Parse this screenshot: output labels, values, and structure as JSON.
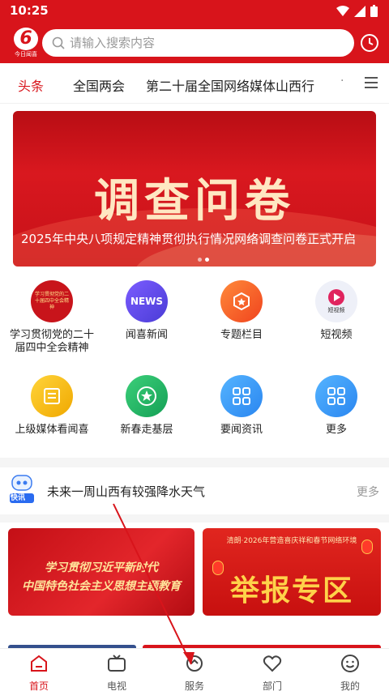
{
  "status_bar": {
    "time": "10:25"
  },
  "header": {
    "logo_text": "今日闻喜",
    "search_placeholder": "请输入搜索内容"
  },
  "tabs": [
    {
      "label": "头条",
      "active": true
    },
    {
      "label": "全国两会",
      "active": false
    },
    {
      "label": "第二十届全国网络媒体山西行",
      "active": false
    }
  ],
  "tabs_more": "·",
  "banner": {
    "headline": "调查问卷",
    "caption": "2025年中央八项规定精神贯彻执行情况网络调查问卷正式开启",
    "slides": 2,
    "active_slide": 2
  },
  "grid": [
    {
      "label": "学习贯彻党的二十届四中全会精神",
      "icon": "party-badge-icon",
      "icon_text": "学习贯彻党的二十届四中全会精神"
    },
    {
      "label": "闻喜新闻",
      "icon": "news-icon",
      "icon_text": "NEWS"
    },
    {
      "label": "专题栏目",
      "icon": "topic-star-icon",
      "icon_text": ""
    },
    {
      "label": "短视频",
      "icon": "short-video-icon",
      "icon_text": "短视频"
    },
    {
      "label": "上级媒体看闻喜",
      "icon": "media-icon",
      "icon_text": ""
    },
    {
      "label": "新春走基层",
      "icon": "spring-star-icon",
      "icon_text": ""
    },
    {
      "label": "要闻资讯",
      "icon": "apps-icon",
      "icon_text": ""
    },
    {
      "label": "更多",
      "icon": "more-apps-icon",
      "icon_text": ""
    }
  ],
  "flash": {
    "badge": "快讯",
    "title": "未来一周山西有较强降水天气",
    "more": "更多"
  },
  "promos": [
    {
      "line1": "学习贯彻习近平新时代",
      "line2": "中国特色社会主义思想主题教育"
    },
    {
      "small": "清朗·2026年营造喜庆祥和春节网络环境",
      "big": "举报专区"
    }
  ],
  "bottom_nav": [
    {
      "label": "首页",
      "icon": "home-icon",
      "active": true
    },
    {
      "label": "电视",
      "icon": "tv-icon",
      "active": false
    },
    {
      "label": "服务",
      "icon": "service-icon",
      "active": false
    },
    {
      "label": "部门",
      "icon": "department-icon",
      "active": false
    },
    {
      "label": "我的",
      "icon": "profile-icon",
      "active": false
    }
  ],
  "colors": {
    "brand_red": "#d8141b",
    "text_dark": "#222222",
    "muted": "#999999"
  }
}
